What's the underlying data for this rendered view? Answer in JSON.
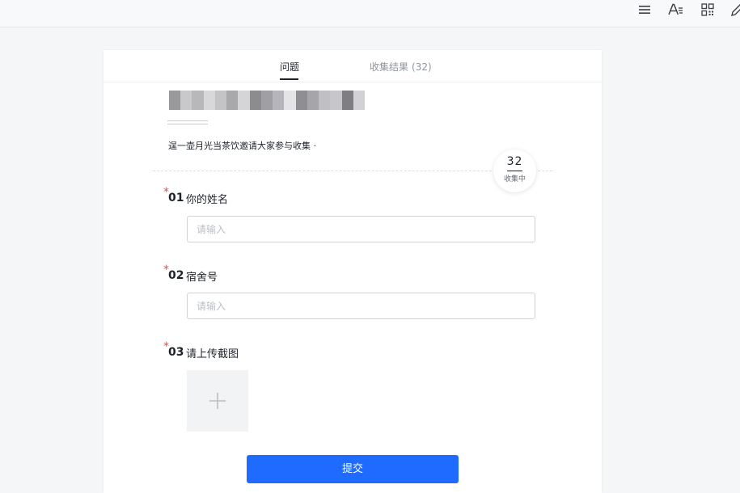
{
  "toolbar": {
    "icons": [
      "menu-icon",
      "text-format-icon",
      "qr-code-icon",
      "edit-icon"
    ]
  },
  "tabs": {
    "questions_label": "问题",
    "results_label": "收集结果",
    "results_count": "(32)"
  },
  "form": {
    "description": "逞一壶月光当茶饮邀请大家参与收集 ·",
    "counter": {
      "value": "32",
      "label": "收集中"
    },
    "questions": [
      {
        "required_mark": "*",
        "number": "01",
        "title": "你的姓名",
        "placeholder": "请输入",
        "value": ""
      },
      {
        "required_mark": "*",
        "number": "02",
        "title": "宿舍号",
        "placeholder": "请输入",
        "value": ""
      },
      {
        "required_mark": "*",
        "number": "03",
        "title": "请上传截图",
        "upload_icon": "plus-icon"
      }
    ],
    "submit_label": "提交"
  },
  "colors": {
    "accent": "#1f6bff",
    "required": "#f54a45",
    "page_background": "#f5f6f7"
  }
}
